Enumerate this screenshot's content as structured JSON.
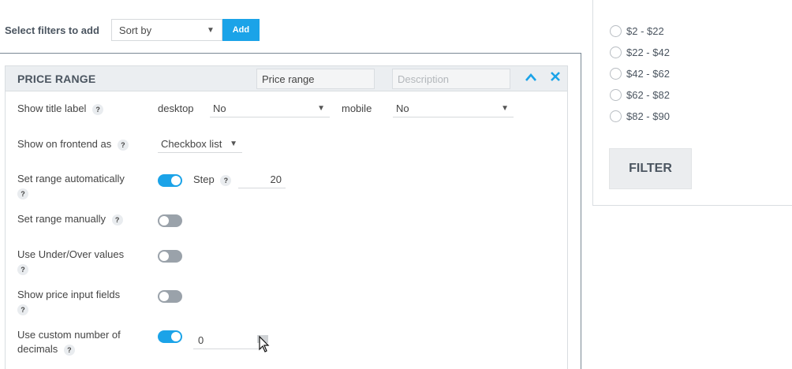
{
  "topbar": {
    "label": "Select filters to add",
    "sort_value": "Sort by",
    "add_label": "Add"
  },
  "panel": {
    "title": "PRICE RANGE",
    "title_input": "Price range",
    "description_placeholder": "Description",
    "rows": {
      "show_title_label": "Show title label",
      "desktop_label": "desktop",
      "desktop_value": "No",
      "mobile_label": "mobile",
      "mobile_value": "No",
      "show_on_frontend": "Show on frontend as",
      "frontend_value": "Checkbox list",
      "set_range_auto": "Set range automatically",
      "step_label": "Step",
      "step_value": "20",
      "set_range_manual": "Set range manually",
      "use_under_over": "Use Under/Over values",
      "show_price_inputs": "Show price input fields",
      "custom_decimals_line1": "Use custom number of",
      "custom_decimals_line2": "decimals",
      "decimals_value": "0"
    },
    "toggles": {
      "set_range_auto": true,
      "set_range_manual": false,
      "use_under_over": false,
      "show_price_inputs": false,
      "custom_decimals": true
    },
    "help_glyph": "?"
  },
  "sidebar": {
    "ranges": [
      "$2 - $22",
      "$22 - $42",
      "$42 - $62",
      "$62 - $82",
      "$82 - $90"
    ],
    "filter_label": "FILTER"
  },
  "icons": {
    "collapse": "chevron-up-icon",
    "close": "close-icon",
    "help": "help-icon",
    "cursor": "mouse-cursor-icon"
  },
  "colors": {
    "accent": "#1ba3e8",
    "toggle_off": "#9aa2aa",
    "header_bg": "#ebeef1"
  }
}
